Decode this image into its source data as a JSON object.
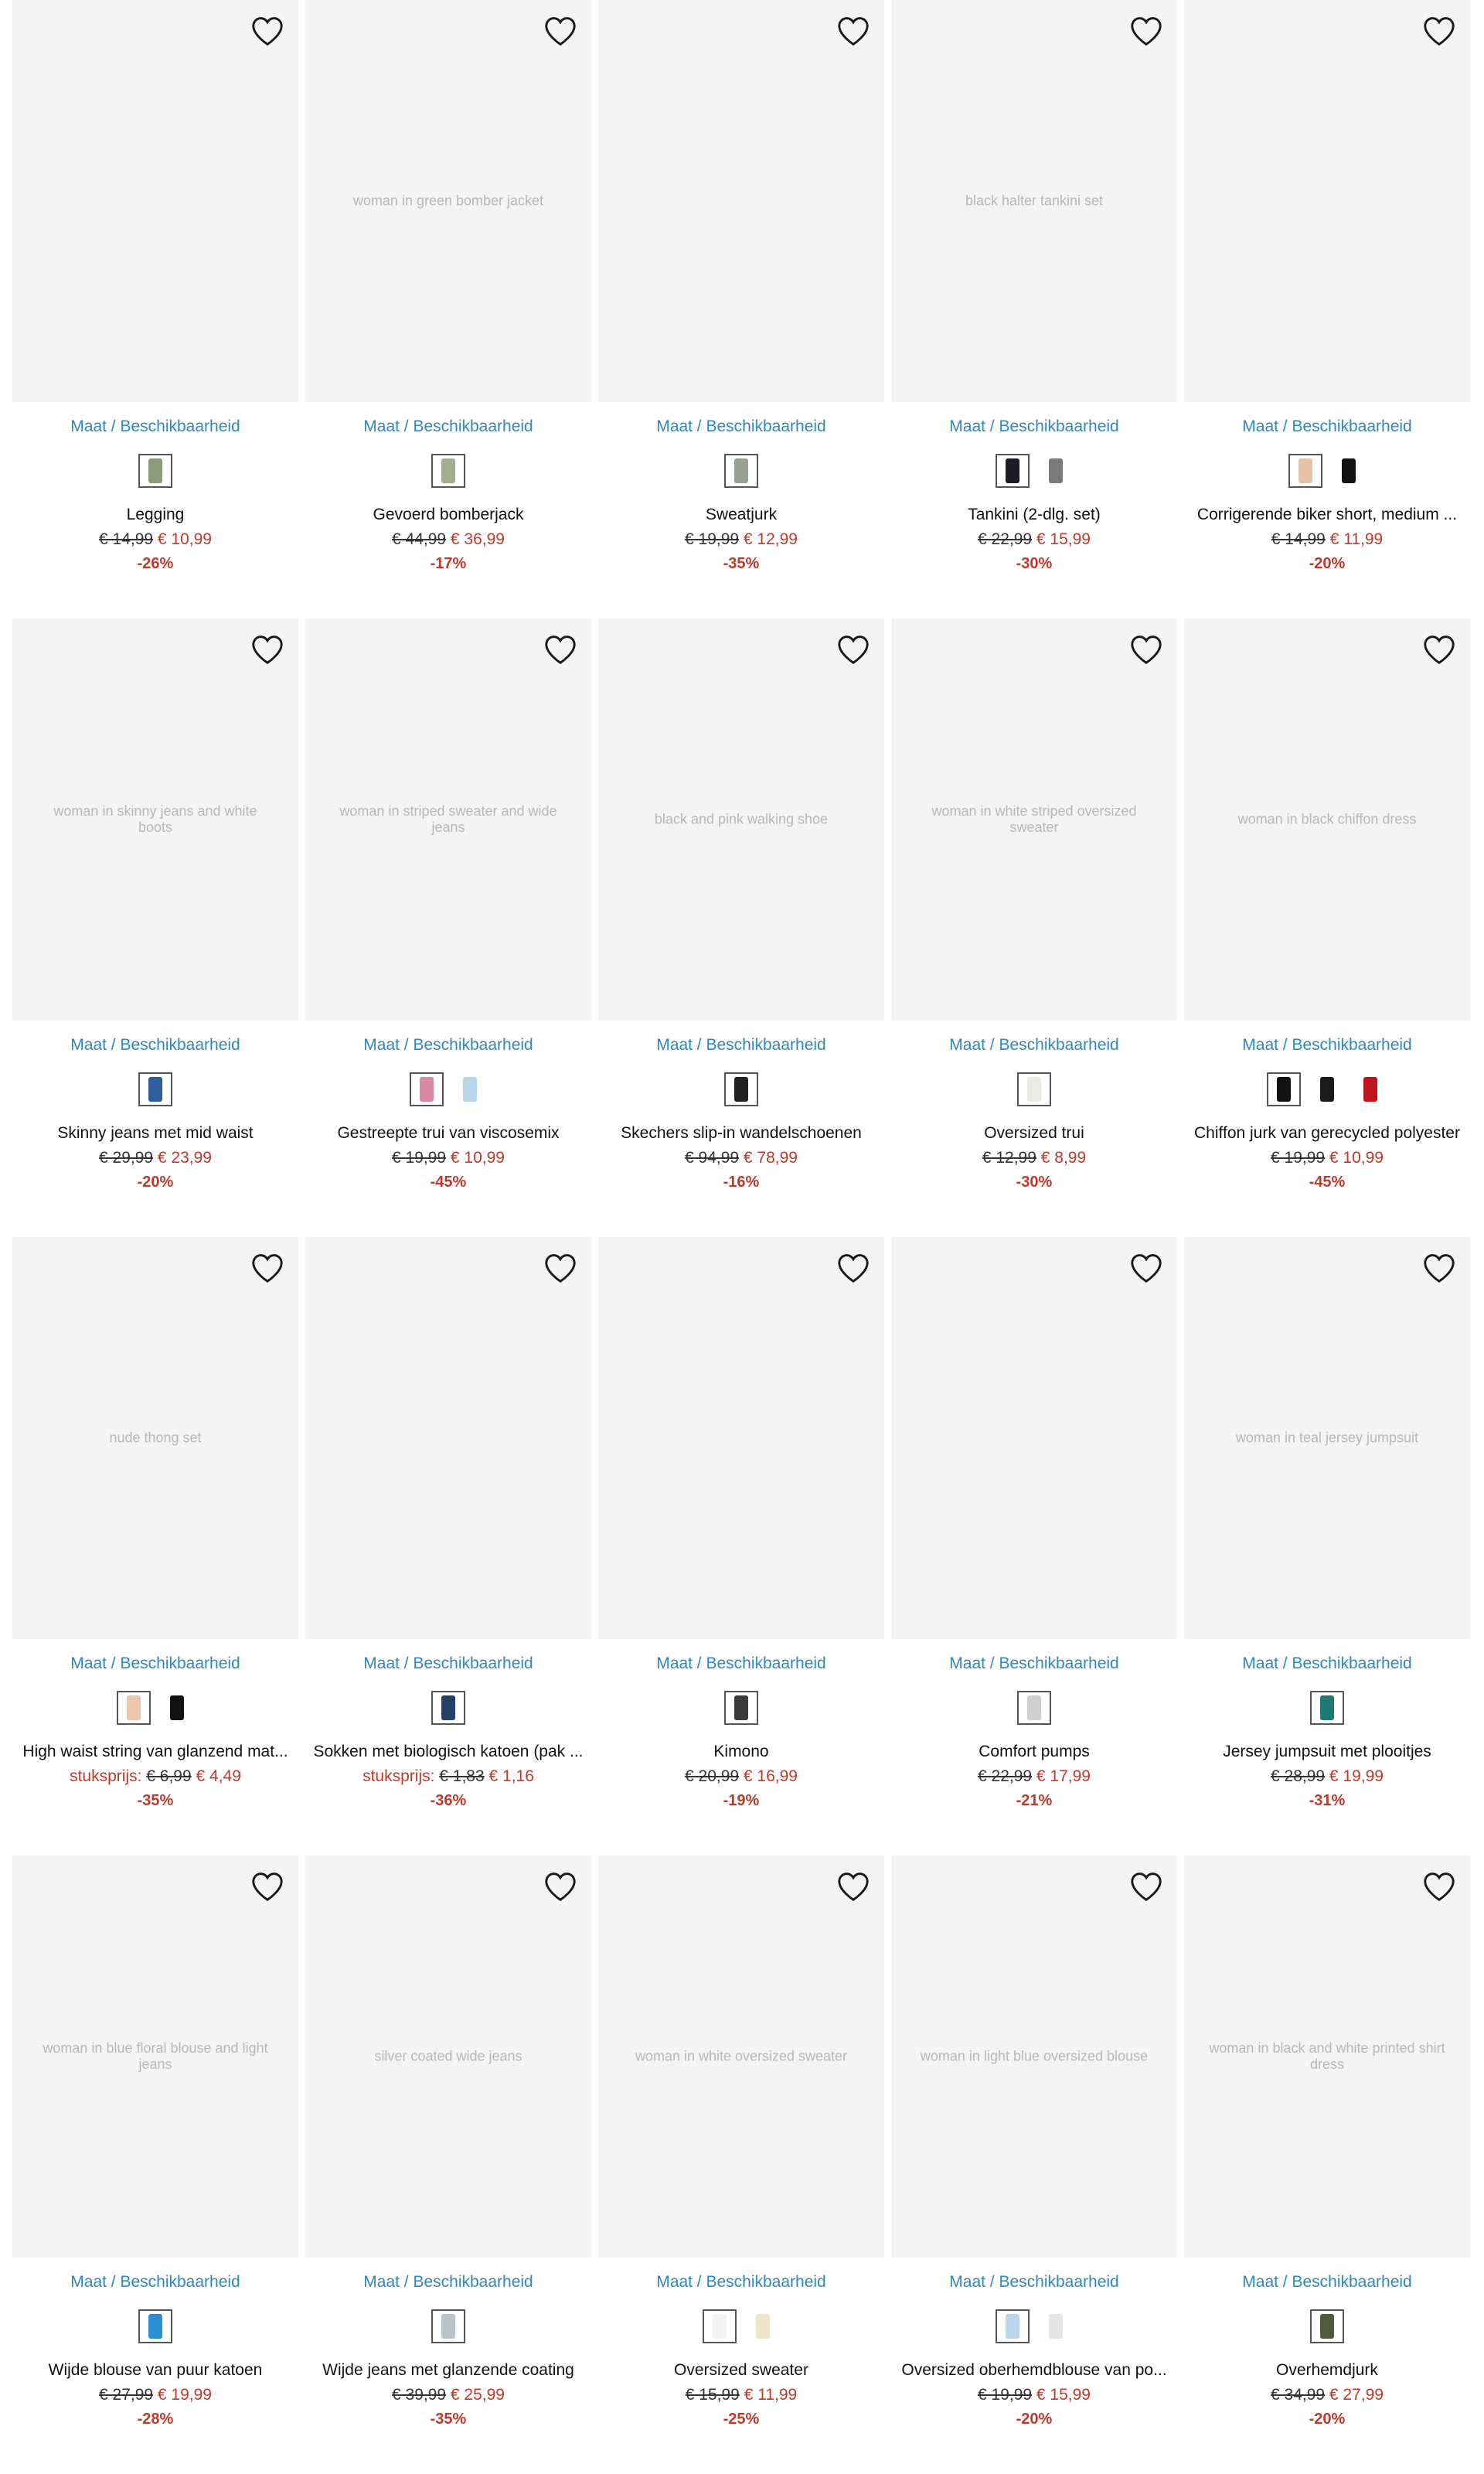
{
  "labels": {
    "size_link": "Maat / Beschikbaarheid"
  },
  "products": [
    {
      "name": "Legging",
      "image": "",
      "old": "€ 14,99",
      "price": "€ 10,99",
      "discount": "-26%",
      "unit": "",
      "swatches": [
        "#8a9d7a"
      ]
    },
    {
      "name": "Gevoerd bomberjack",
      "image": "woman in green bomber jacket",
      "old": "€ 44,99",
      "price": "€ 36,99",
      "discount": "-17%",
      "unit": "",
      "swatches": [
        "#a4ad8e"
      ]
    },
    {
      "name": "Sweatjurk",
      "image": "",
      "old": "€ 19,99",
      "price": "€ 12,99",
      "discount": "-35%",
      "unit": "",
      "swatches": [
        "#9aa194"
      ]
    },
    {
      "name": "Tankini (2-dlg. set)",
      "image": "black halter tankini set",
      "old": "€ 22,99",
      "price": "€ 15,99",
      "discount": "-30%",
      "unit": "",
      "swatches": [
        "#1f1b22",
        "#7a7a7a"
      ]
    },
    {
      "name": "Corrigerende biker short, medium ...",
      "image": "",
      "old": "€ 14,99",
      "price": "€ 11,99",
      "discount": "-20%",
      "unit": "",
      "swatches": [
        "#e6c2a6",
        "#111111"
      ]
    },
    {
      "name": "Skinny jeans met mid waist",
      "image": "woman in skinny jeans and white boots",
      "old": "€ 29,99",
      "price": "€ 23,99",
      "discount": "-20%",
      "unit": "",
      "swatches": [
        "#2f5da0"
      ]
    },
    {
      "name": "Gestreepte trui van viscosemix",
      "image": "woman in striped sweater and wide jeans",
      "old": "€ 19,99",
      "price": "€ 10,99",
      "discount": "-45%",
      "unit": "",
      "swatches": [
        "#d88aa5",
        "#b7d6ea"
      ]
    },
    {
      "name": "Skechers slip-in wandelschoenen",
      "image": "black and pink walking shoe",
      "old": "€ 94,99",
      "price": "€ 78,99",
      "discount": "-16%",
      "unit": "",
      "swatches": [
        "#222222"
      ]
    },
    {
      "name": "Oversized trui",
      "image": "woman in white striped oversized sweater",
      "old": "€ 12,99",
      "price": "€ 8,99",
      "discount": "-30%",
      "unit": "",
      "swatches": [
        "#ecebe4"
      ]
    },
    {
      "name": "Chiffon jurk van gerecycled polyester",
      "image": "woman in black chiffon dress",
      "old": "€ 19,99",
      "price": "€ 10,99",
      "discount": "-45%",
      "unit": "",
      "swatches": [
        "#111111",
        "#1a1a1a",
        "#c0141c"
      ]
    },
    {
      "name": "High waist string van glanzend mat...",
      "image": "nude thong set",
      "old": "€ 6,99",
      "price": "€ 4,49",
      "discount": "-35%",
      "unit": "stuksprijs:",
      "swatches": [
        "#ecc7ad",
        "#111111"
      ]
    },
    {
      "name": "Sokken met biologisch katoen (pak ...",
      "image": "",
      "old": "€ 1,83",
      "price": "€ 1,16",
      "discount": "-36%",
      "unit": "stuksprijs:",
      "swatches": [
        "#234066"
      ]
    },
    {
      "name": "Kimono",
      "image": "",
      "old": "€ 20,99",
      "price": "€ 16,99",
      "discount": "-19%",
      "unit": "",
      "swatches": [
        "#3a3a3a"
      ]
    },
    {
      "name": "Comfort pumps",
      "image": "",
      "old": "€ 22,99",
      "price": "€ 17,99",
      "discount": "-21%",
      "unit": "",
      "swatches": [
        "#cfcfcf"
      ]
    },
    {
      "name": "Jersey jumpsuit met plooitjes",
      "image": "woman in teal jersey jumpsuit",
      "old": "€ 28,99",
      "price": "€ 19,99",
      "discount": "-31%",
      "unit": "",
      "swatches": [
        "#1f7a72"
      ]
    },
    {
      "name": "Wijde blouse van puur katoen",
      "image": "woman in blue floral blouse and light jeans",
      "old": "€ 27,99",
      "price": "€ 19,99",
      "discount": "-28%",
      "unit": "",
      "swatches": [
        "#2b8fd6"
      ]
    },
    {
      "name": "Wijde jeans met glanzende coating",
      "image": "silver coated wide jeans",
      "old": "€ 39,99",
      "price": "€ 25,99",
      "discount": "-35%",
      "unit": "",
      "swatches": [
        "#b9c4cc"
      ]
    },
    {
      "name": "Oversized sweater",
      "image": "woman in white oversized sweater",
      "old": "€ 15,99",
      "price": "€ 11,99",
      "discount": "-25%",
      "unit": "",
      "swatches": [
        "#f3f3f3",
        "#efe6c8"
      ]
    },
    {
      "name": "Oversized oberhemdblouse van po...",
      "image": "woman in light blue oversized blouse",
      "old": "€ 19,99",
      "price": "€ 15,99",
      "discount": "-20%",
      "unit": "",
      "swatches": [
        "#bcd6ec",
        "#e6e6e6"
      ]
    },
    {
      "name": "Overhemdjurk",
      "image": "woman in black and white printed shirt dress",
      "old": "€ 34,99",
      "price": "€ 27,99",
      "discount": "-20%",
      "unit": "",
      "swatches": [
        "#4f5a3e"
      ]
    }
  ]
}
